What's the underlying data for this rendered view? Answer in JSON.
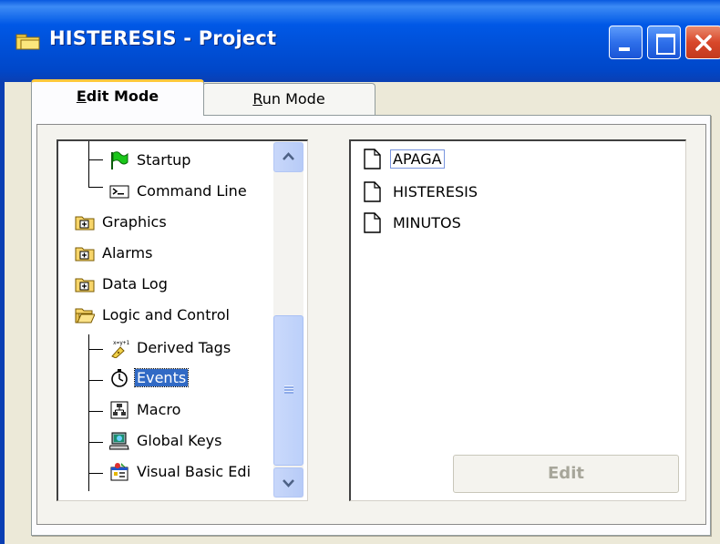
{
  "window": {
    "title": "HISTERESIS - Project",
    "controls": [
      "minimize",
      "maximize",
      "close"
    ]
  },
  "tabs": [
    {
      "label": "Edit Mode",
      "underline": "E",
      "rest": "dit Mode",
      "active": true
    },
    {
      "label": "Run Mode",
      "underline": "R",
      "rest": "un Mode",
      "active": false
    }
  ],
  "tree": {
    "items": [
      {
        "label": "Startup",
        "icon": "green-flag-icon",
        "level": 1
      },
      {
        "label": "Command Line",
        "icon": "command-line-icon",
        "level": 1
      },
      {
        "label": "Graphics",
        "icon": "folder-plus-icon",
        "level": 0
      },
      {
        "label": "Alarms",
        "icon": "folder-plus-icon",
        "level": 0
      },
      {
        "label": "Data Log",
        "icon": "folder-plus-icon",
        "level": 0
      },
      {
        "label": "Logic and Control",
        "icon": "folder-open-icon",
        "level": 0
      },
      {
        "label": "Derived Tags",
        "icon": "derived-tags-icon",
        "level": 1
      },
      {
        "label": "Events",
        "icon": "stopwatch-icon",
        "level": 1,
        "selected": true
      },
      {
        "label": "Macro",
        "icon": "macro-icon",
        "level": 1
      },
      {
        "label": "Global Keys",
        "icon": "global-keys-icon",
        "level": 1
      },
      {
        "label": "Visual Basic Edi",
        "icon": "visual-basic-icon",
        "level": 1
      }
    ]
  },
  "list": {
    "items": [
      {
        "label": "APAGA",
        "focused": true
      },
      {
        "label": "HISTERESIS",
        "focused": false
      },
      {
        "label": "MINUTOS",
        "focused": false
      }
    ]
  },
  "buttons": {
    "edit_label": "Edit",
    "edit_enabled": false
  },
  "colors": {
    "titlebar": "#0058e6",
    "selection": "#316ac5",
    "face": "#ece9d8",
    "active_tab_accent": "#ffc83c"
  }
}
